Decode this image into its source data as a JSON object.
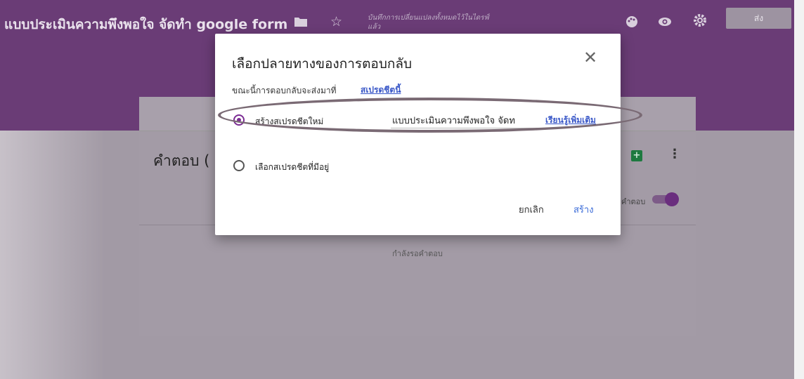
{
  "header": {
    "form_title": "แบบประเมินความพึงพอใจ จัดทำ google form",
    "folder_icon": "folder-icon",
    "star_icon": "star-icon",
    "save_status": "บันทึกการเปลี่ยนแปลงทั้งหมดไว้ในไดรฟ์แล้ว",
    "palette_icon": "palette-icon",
    "preview_icon": "eye-icon",
    "settings_icon": "gear-icon",
    "send_label": "ส่ง",
    "color": "#6a3c76"
  },
  "responses": {
    "title": "คำตอบ (",
    "accepting_label": "คำตอบ",
    "waiting_text": "กำลังรอคำตอบ",
    "accepting": true
  },
  "dialog": {
    "title": "เลือกปลายทางของการตอบกลับ",
    "current_dest_text": "ขณะนี้การตอบกลับจะส่งมาที่",
    "current_dest_link": "สเปรดชีตนี้",
    "options": [
      {
        "label": "สร้างสเปรดชีตใหม่",
        "selected": true
      },
      {
        "label": "เลือกสเปรดชีตที่มีอยู่",
        "selected": false
      }
    ],
    "new_sheet_name": "แบบประเมินความพึงพอใจ จัดท",
    "learn_more": "เรียนรู้เพิ่มเติม",
    "cancel_label": "ยกเลิก",
    "create_label": "สร้าง",
    "accent_color": "#7b2b93",
    "link_color": "#3a58c8"
  }
}
